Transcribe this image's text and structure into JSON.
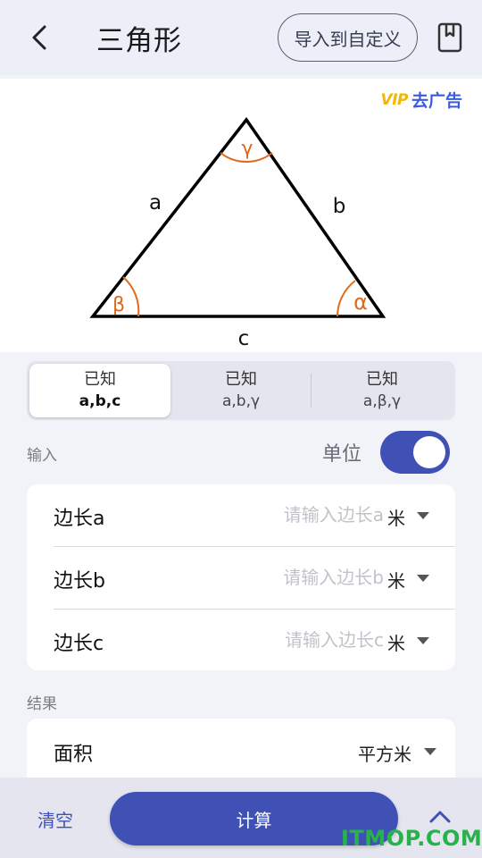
{
  "header": {
    "title": "三角形",
    "import_label": "导入到自定义"
  },
  "promo": {
    "vip_badge": "VIP",
    "remove_ads_label": "去广告"
  },
  "diagram": {
    "side_a": "a",
    "side_b": "b",
    "side_c": "c",
    "angle_alpha": "α",
    "angle_beta": "β",
    "angle_gamma": "γ",
    "line_color": "#000000",
    "angle_color": "#e06a1a"
  },
  "modes": [
    {
      "line1": "已知",
      "line2": "a,b,c",
      "active": true
    },
    {
      "line1": "已知",
      "line2": "a,b,γ",
      "active": false
    },
    {
      "line1": "已知",
      "line2": "a,β,γ",
      "active": false
    }
  ],
  "input_section": {
    "title": "输入",
    "unit_toggle_label": "单位",
    "unit_toggle_on": true
  },
  "inputs": [
    {
      "label": "边长a",
      "placeholder": "请输入边长a",
      "value": "",
      "unit": "米"
    },
    {
      "label": "边长b",
      "placeholder": "请输入边长b",
      "value": "",
      "unit": "米"
    },
    {
      "label": "边长c",
      "placeholder": "请输入边长c",
      "value": "",
      "unit": "米"
    }
  ],
  "result_section": {
    "title": "结果",
    "rows": [
      {
        "label": "面积",
        "unit": "平方米"
      }
    ]
  },
  "footer": {
    "clear_label": "清空",
    "calculate_label": "计算",
    "watermark": "ITMOP.COM"
  },
  "colors": {
    "accent": "#3f51b5",
    "link": "#3b5bdb",
    "vip": "#f2b705",
    "watermark": "#27b34a"
  }
}
